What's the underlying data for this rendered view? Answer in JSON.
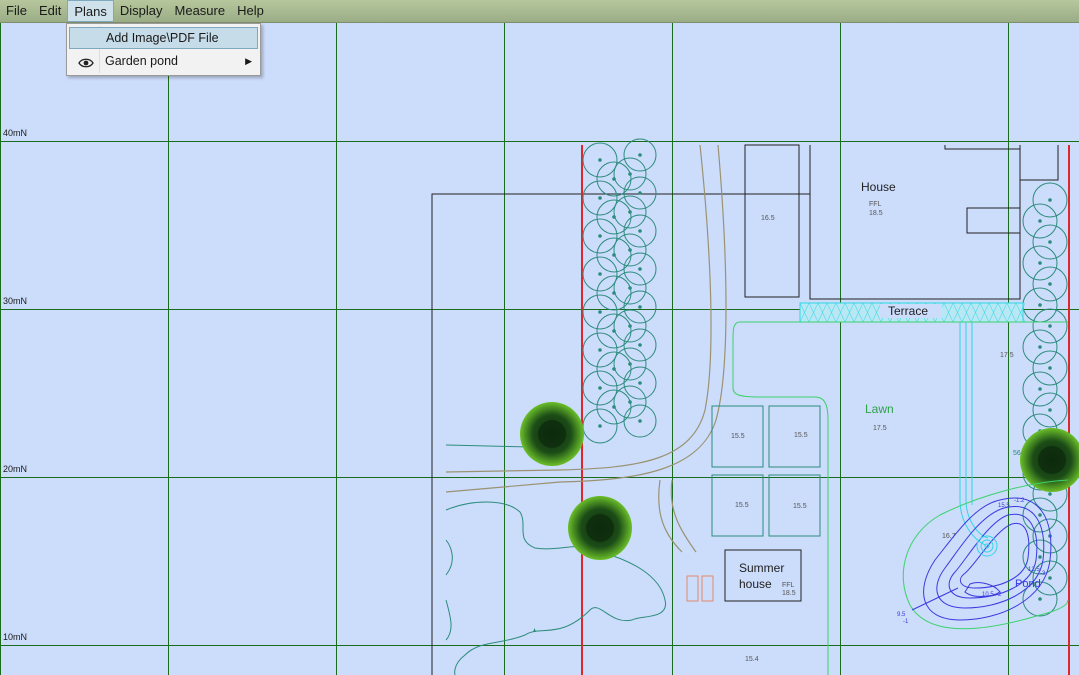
{
  "menubar": {
    "items": [
      "File",
      "Edit",
      "Plans",
      "Display",
      "Measure",
      "Help"
    ],
    "active_index": 2
  },
  "plans_menu": {
    "items": [
      {
        "label": "Add Image\\PDF File",
        "icon": "",
        "highlighted": true
      },
      {
        "label": "Garden pond",
        "icon": "eye-icon",
        "submenu": true
      }
    ]
  },
  "grid": {
    "northing_labels": [
      "40mN",
      "30mN",
      "20mN",
      "10mN"
    ]
  },
  "plan_labels": {
    "house": "House",
    "house_ffl": "FFL",
    "house_ffl_value": "18.5",
    "house_level": "16.5",
    "terrace": "Terrace",
    "lawn": "Lawn",
    "lawn_level": "17.5",
    "level_right": "17.5",
    "summer_house_line1": "Summer",
    "summer_house_line2": "house",
    "summer_ffl": "FFL",
    "summer_ffl_value": "18.5",
    "beds": [
      "15.5",
      "15.5",
      "15.5",
      "15.5"
    ],
    "level_bottom": "15.4",
    "pond": "Pond",
    "pond_level_left": "16.7",
    "pond_contour_1": "-1.2",
    "pond_contour_2": "15.5",
    "pond_contour_3": "12.5",
    "pond_contour_4": "-3",
    "pond_contour_5": "10.5",
    "pond_contour_6": "-2",
    "pond_contour_7": "9.5",
    "pond_contour_8": "-1",
    "tree_label": "56"
  },
  "colors": {
    "background": "#ccdcfb",
    "grid": "#1a6b1a",
    "boundary_red": "#e0262a",
    "hedge": "#2c8c7c",
    "lawn_green": "#3ad26a",
    "pond_blue": "#3a3ae0",
    "terrace_cyan": "#2fd6e6",
    "path_tan": "#9a9272"
  }
}
